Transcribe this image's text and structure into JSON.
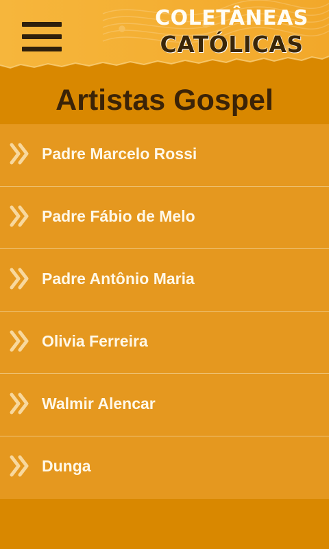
{
  "header": {
    "menu_icon": "hamburger-menu-icon",
    "brand_line1": "COLETÂNEAS",
    "brand_line2": "CATÓLICAS"
  },
  "page": {
    "title": "Artistas Gospel"
  },
  "artists": [
    {
      "label": "Padre Marcelo Rossi",
      "icon": "double-chevron-right-icon"
    },
    {
      "label": "Padre Fábio de Melo",
      "icon": "double-chevron-right-icon"
    },
    {
      "label": "Padre Antônio Maria",
      "icon": "double-chevron-right-icon"
    },
    {
      "label": "Olivia Ferreira",
      "icon": "double-chevron-right-icon"
    },
    {
      "label": "Walmir Alencar",
      "icon": "double-chevron-right-icon"
    },
    {
      "label": "Dunga",
      "icon": "double-chevron-right-icon"
    }
  ],
  "colors": {
    "background": "#d98800",
    "header": "#f5b43a",
    "list_item": "#e5981f",
    "divider": "#efc57a",
    "title_text": "#3b2307",
    "item_text": "#fff8e8"
  }
}
